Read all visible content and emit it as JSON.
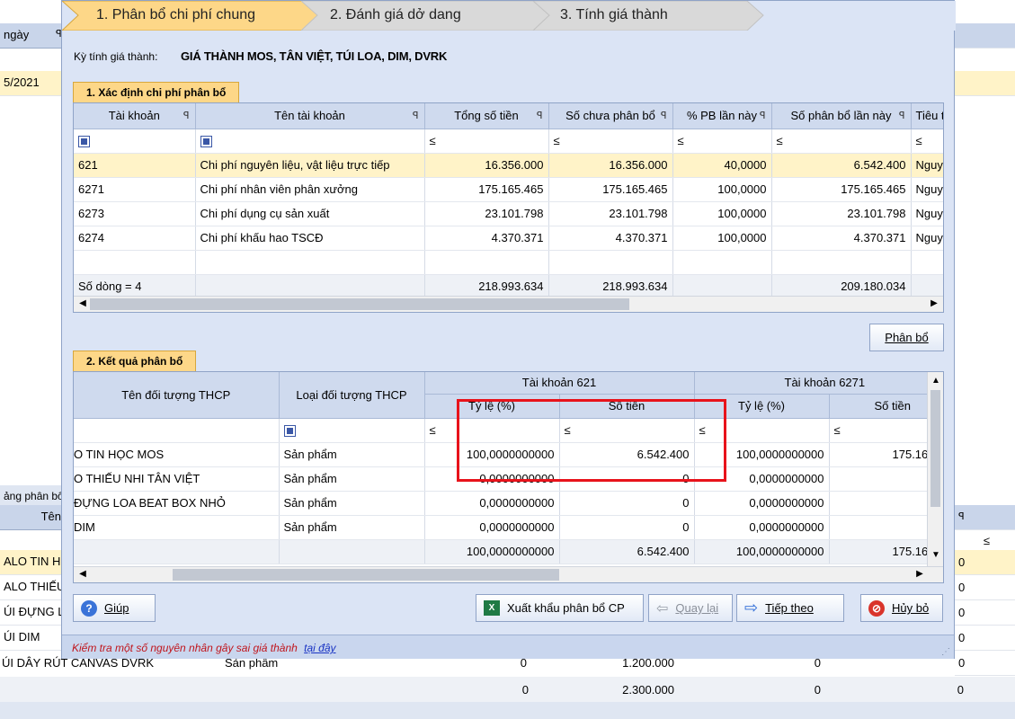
{
  "wizard": {
    "steps": [
      "1. Phân bổ chi phí chung",
      "2. Đánh giá dở dang",
      "3. Tính giá thành"
    ]
  },
  "period": {
    "label": "Kỳ tính giá thành:",
    "value": "GIÁ THÀNH MOS, TÂN VIỆT, TÚI LOA, DIM, DVRK"
  },
  "section1": {
    "title": "1. Xác định chi phí phân bổ",
    "columns": [
      "Tài khoản",
      "Tên tài khoản",
      "Tổng số tiền",
      "Số chưa phân bổ",
      "% PB lần này",
      "Số phân bổ lần này",
      "Tiêu t"
    ],
    "filter_op": "≤",
    "rows": [
      {
        "account": "621",
        "name": "Chi phí nguyên liệu, vật liệu trực tiếp",
        "total": "16.356.000",
        "unallocated": "16.356.000",
        "pct": "40,0000",
        "allocated": "6.542.400",
        "criteria": "Nguyên"
      },
      {
        "account": "6271",
        "name": "Chi phí nhân viên phân xưởng",
        "total": "175.165.465",
        "unallocated": "175.165.465",
        "pct": "100,0000",
        "allocated": "175.165.465",
        "criteria": "Nguyên"
      },
      {
        "account": "6273",
        "name": "Chi phí dụng cụ sản xuất",
        "total": "23.101.798",
        "unallocated": "23.101.798",
        "pct": "100,0000",
        "allocated": "23.101.798",
        "criteria": "Nguyên"
      },
      {
        "account": "6274",
        "name": "Chi phí khấu hao TSCĐ",
        "total": "4.370.371",
        "unallocated": "4.370.371",
        "pct": "100,0000",
        "allocated": "4.370.371",
        "criteria": "Nguyên"
      }
    ],
    "footer": {
      "count": "Số dòng = 4",
      "total": "218.993.634",
      "unallocated": "218.993.634",
      "allocated": "209.180.034"
    }
  },
  "allocate_button": "Phân bổ",
  "section2": {
    "title": "2. Kết quả phân bổ",
    "col_object": "Tên đối tượng THCP",
    "col_type": "Loại đối tượng THCP",
    "group1": "Tài khoản 621",
    "group2": "Tài khoản 6271",
    "sub_ratio": "Tỷ lệ (%)",
    "sub_amount": "Số tiền",
    "filter_op": "≤",
    "rows": [
      {
        "object": "O TIN HỌC MOS",
        "type": "Sản phẩm",
        "r1": "100,0000000000",
        "a1": "6.542.400",
        "r2": "100,0000000000",
        "a2": "175.16"
      },
      {
        "object": "O THIẾU NHI TÂN VIỆT",
        "type": "Sản phẩm",
        "r1": "0,0000000000",
        "a1": "0",
        "r2": "0,0000000000",
        "a2": ""
      },
      {
        "object": "ĐỰNG LOA BEAT BOX NHỎ",
        "type": "Sản phẩm",
        "r1": "0,0000000000",
        "a1": "0",
        "r2": "0,0000000000",
        "a2": ""
      },
      {
        "object": "DIM",
        "type": "Sản phẩm",
        "r1": "0,0000000000",
        "a1": "0",
        "r2": "0,0000000000",
        "a2": ""
      }
    ],
    "footer": {
      "r1": "100,0000000000",
      "a1": "6.542.400",
      "r2": "100,0000000000",
      "a2": "175.16"
    }
  },
  "buttons": {
    "help": "Giúp",
    "export": "Xuất khẩu phân bổ CP",
    "back": "Quay lại",
    "next": "Tiếp theo",
    "cancel": "Hủy bỏ"
  },
  "status": {
    "text": "Kiểm tra một số nguyên nhân gây sai giá thành",
    "link": "tại đây"
  },
  "background": {
    "header_left": "ngày",
    "date": "5/2021",
    "group_label": "ảng phân bổ",
    "group_col": "Tên",
    "filter_op": "≤",
    "left_items": [
      "ALO TIN HỌ",
      "ALO THIẾU",
      "ÚI ĐỰNG L",
      "ÚI DIM",
      "ÚI DÂY RÚT CANVAS DVRK"
    ],
    "bottom_type": "Sản phẩm",
    "bottom_values": [
      "0",
      "1.200.000",
      "0",
      "0"
    ],
    "total_values": [
      "0",
      "2.300.000",
      "0",
      "0"
    ],
    "right_values": [
      "0",
      "0",
      "0",
      "0",
      "0"
    ]
  }
}
